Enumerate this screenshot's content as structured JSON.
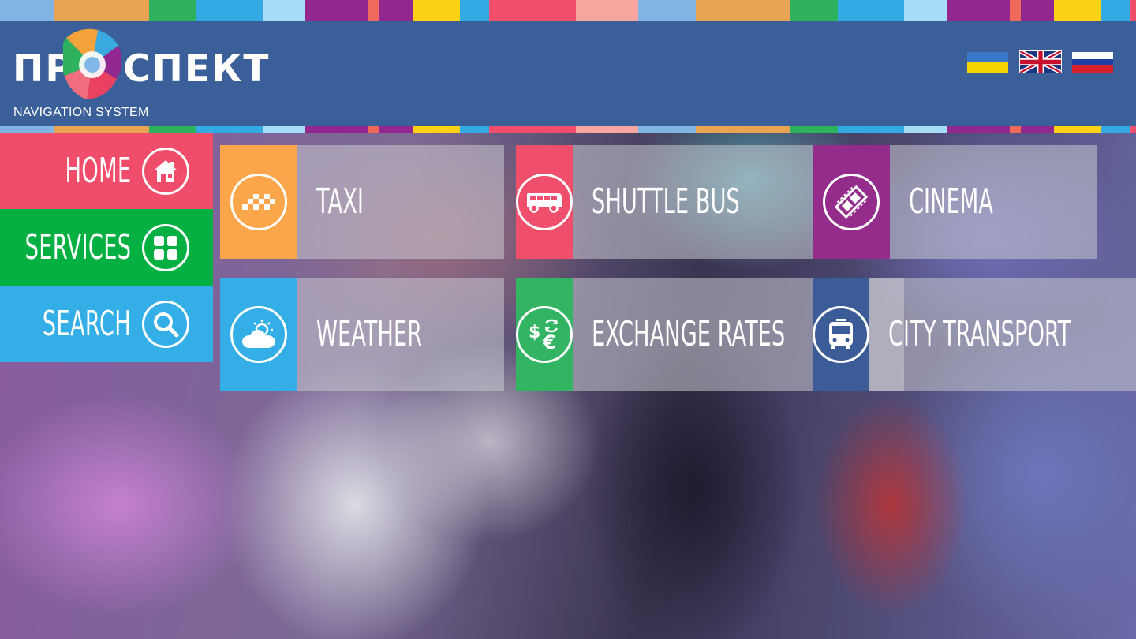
{
  "brand": {
    "logo_prefix": "ПР",
    "logo_suffix": "СПЕКТ",
    "tagline": "NAVIGATION SYSTEM"
  },
  "colors": {
    "header": "#3b5f98",
    "red": "#ef4d69",
    "green": "#05b043",
    "blue": "#33aee6",
    "orange": "#fba64a",
    "pink": "#f04f6c",
    "purple": "#942c8c",
    "teal_green": "#32b463",
    "navy": "#3c5c98"
  },
  "languages": [
    {
      "name": "ukrainian-flag"
    },
    {
      "name": "english-flag"
    },
    {
      "name": "russian-flag"
    }
  ],
  "menu": {
    "home": {
      "label": "HOME",
      "icon": "home-icon"
    },
    "services": {
      "label": "SERVICES",
      "icon": "grid-icon"
    },
    "search": {
      "label": "SEARCH",
      "icon": "search-icon"
    }
  },
  "tiles": {
    "taxi": {
      "label": "TAXI",
      "icon": "taxi-icon"
    },
    "shuttle_bus": {
      "label": "SHUTTLE BUS",
      "icon": "bus-icon"
    },
    "cinema": {
      "label": "CINEMA",
      "icon": "film-icon"
    },
    "weather": {
      "label": "WEATHER",
      "icon": "weather-icon"
    },
    "exchange_rates": {
      "label": "EXCHANGE RATES",
      "icon": "currency-icon"
    },
    "city_transport": {
      "label": "CITY TRANSPORT",
      "icon": "trolleybus-icon"
    }
  }
}
